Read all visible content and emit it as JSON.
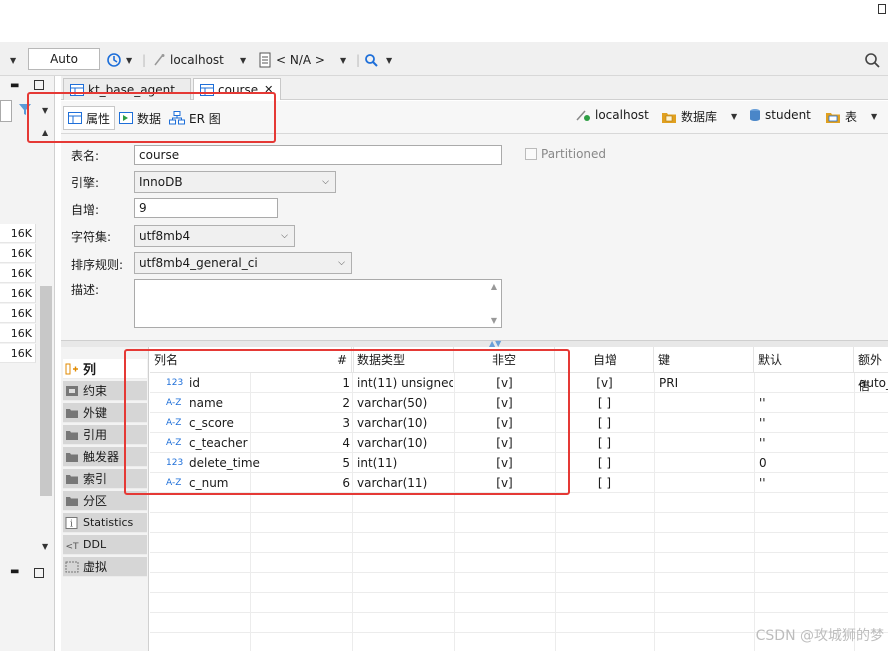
{
  "toolbar": {
    "auto_value": "Auto",
    "host_label": "localhost",
    "schema_label": "< N/A >"
  },
  "left_sizes": [
    "16K",
    "16K",
    "16K",
    "16K",
    "16K",
    "16K",
    "16K",
    "16K"
  ],
  "tabs": [
    {
      "label": "kt_base_agent"
    },
    {
      "label": "course"
    }
  ],
  "subtabs": {
    "properties": "属性",
    "data": "数据",
    "er": "ER 图",
    "host": "localhost",
    "database": "数据库",
    "schema": "student",
    "table": "表"
  },
  "props": {
    "table_name_label": "表名:",
    "table_name_value": "course",
    "partitioned_label": "Partitioned",
    "engine_label": "引擎:",
    "engine_value": "InnoDB",
    "auto_inc_label": "自增:",
    "auto_inc_value": "9",
    "charset_label": "字符集:",
    "charset_value": "utf8mb4",
    "collation_label": "排序规则:",
    "collation_value": "utf8mb4_general_ci",
    "comment_label": "描述:"
  },
  "sidenav": [
    {
      "label": "列",
      "icon": "columns-icon"
    },
    {
      "label": "约束",
      "icon": "constraint-icon"
    },
    {
      "label": "外键",
      "icon": "folder-icon"
    },
    {
      "label": "引用",
      "icon": "folder-icon"
    },
    {
      "label": "触发器",
      "icon": "folder-icon"
    },
    {
      "label": "索引",
      "icon": "folder-icon"
    },
    {
      "label": "分区",
      "icon": "folder-icon"
    },
    {
      "label": "Statistics",
      "icon": "info-icon"
    },
    {
      "label": "DDL",
      "icon": "ddl-icon"
    },
    {
      "label": "虚拟",
      "icon": "virtual-icon"
    }
  ],
  "columns_table": {
    "headers": [
      "列名",
      "#",
      "数据类型",
      "非空",
      "自增",
      "键",
      "默认",
      "额外信"
    ],
    "rows": [
      {
        "type_icon": "123",
        "name": "id",
        "num": "1",
        "dtype": "int(11) unsigned",
        "notnull": "[v]",
        "autoinc": "[v]",
        "key": "PRI",
        "default": "",
        "extra": "auto_"
      },
      {
        "type_icon": "A-Z",
        "name": "name",
        "num": "2",
        "dtype": "varchar(50)",
        "notnull": "[v]",
        "autoinc": "[ ]",
        "key": "",
        "default": "''",
        "extra": ""
      },
      {
        "type_icon": "A-Z",
        "name": "c_score",
        "num": "3",
        "dtype": "varchar(10)",
        "notnull": "[v]",
        "autoinc": "[ ]",
        "key": "",
        "default": "''",
        "extra": ""
      },
      {
        "type_icon": "A-Z",
        "name": "c_teacher",
        "num": "4",
        "dtype": "varchar(10)",
        "notnull": "[v]",
        "autoinc": "[ ]",
        "key": "",
        "default": "''",
        "extra": ""
      },
      {
        "type_icon": "123",
        "name": "delete_time",
        "num": "5",
        "dtype": "int(11)",
        "notnull": "[v]",
        "autoinc": "[ ]",
        "key": "",
        "default": "0",
        "extra": ""
      },
      {
        "type_icon": "A-Z",
        "name": "c_num",
        "num": "6",
        "dtype": "varchar(11)",
        "notnull": "[v]",
        "autoinc": "[ ]",
        "key": "",
        "default": "''",
        "extra": ""
      }
    ]
  },
  "watermark": "CSDN @攻城狮的梦",
  "colors": {
    "highlight": "#e53935",
    "accent": "#1e6fd9"
  }
}
